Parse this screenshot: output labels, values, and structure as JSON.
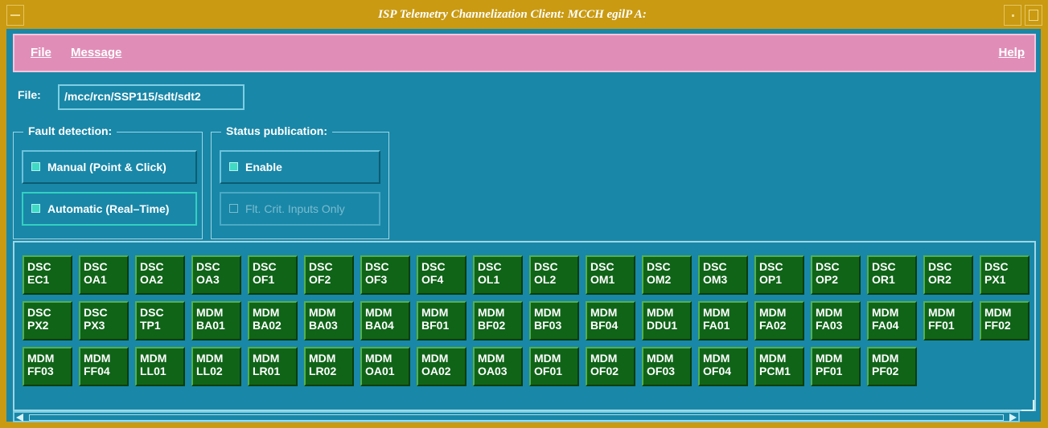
{
  "window": {
    "title": "ISP Telemetry Channelization Client: MCCH egilP A:"
  },
  "menubar": {
    "file": "File",
    "message": "Message",
    "help": "Help"
  },
  "file_row": {
    "label": "File:",
    "value": "/mcc/rcn/SSP115/sdt/sdt2"
  },
  "fault_detection": {
    "title": "Fault detection:",
    "manual": "Manual (Point & Click)",
    "automatic": "Automatic (Real–Time)",
    "selected": "automatic"
  },
  "status_publication": {
    "title": "Status publication:",
    "enable": "Enable",
    "flt_crit": "Flt. Crit. Inputs Only",
    "flt_crit_enabled": false
  },
  "channels": [
    [
      "DSC",
      "EC1"
    ],
    [
      "DSC",
      "OA1"
    ],
    [
      "DSC",
      "OA2"
    ],
    [
      "DSC",
      "OA3"
    ],
    [
      "DSC",
      "OF1"
    ],
    [
      "DSC",
      "OF2"
    ],
    [
      "DSC",
      "OF3"
    ],
    [
      "DSC",
      "OF4"
    ],
    [
      "DSC",
      "OL1"
    ],
    [
      "DSC",
      "OL2"
    ],
    [
      "DSC",
      "OM1"
    ],
    [
      "DSC",
      "OM2"
    ],
    [
      "DSC",
      "OM3"
    ],
    [
      "DSC",
      "OP1"
    ],
    [
      "DSC",
      "OP2"
    ],
    [
      "DSC",
      "OR1"
    ],
    [
      "DSC",
      "OR2"
    ],
    [
      "DSC",
      "PX1"
    ],
    [
      "DSC",
      "PX2"
    ],
    [
      "DSC",
      "PX3"
    ],
    [
      "DSC",
      "TP1"
    ],
    [
      "MDM",
      "BA01"
    ],
    [
      "MDM",
      "BA02"
    ],
    [
      "MDM",
      "BA03"
    ],
    [
      "MDM",
      "BA04"
    ],
    [
      "MDM",
      "BF01"
    ],
    [
      "MDM",
      "BF02"
    ],
    [
      "MDM",
      "BF03"
    ],
    [
      "MDM",
      "BF04"
    ],
    [
      "MDM",
      "DDU1"
    ],
    [
      "MDM",
      "FA01"
    ],
    [
      "MDM",
      "FA02"
    ],
    [
      "MDM",
      "FA03"
    ],
    [
      "MDM",
      "FA04"
    ],
    [
      "MDM",
      "FF01"
    ],
    [
      "MDM",
      "FF02"
    ],
    [
      "MDM",
      "FF03"
    ],
    [
      "MDM",
      "FF04"
    ],
    [
      "MDM",
      "LL01"
    ],
    [
      "MDM",
      "LL02"
    ],
    [
      "MDM",
      "LR01"
    ],
    [
      "MDM",
      "LR02"
    ],
    [
      "MDM",
      "OA01"
    ],
    [
      "MDM",
      "OA02"
    ],
    [
      "MDM",
      "OA03"
    ],
    [
      "MDM",
      "OF01"
    ],
    [
      "MDM",
      "OF02"
    ],
    [
      "MDM",
      "OF03"
    ],
    [
      "MDM",
      "OF04"
    ],
    [
      "MDM",
      "PCM1"
    ],
    [
      "MDM",
      "PF01"
    ],
    [
      "MDM",
      "PF02"
    ]
  ],
  "colors": {
    "frame": "#c99a12",
    "client": "#1987a8",
    "menubar": "#e08eb8",
    "channel": "#106418",
    "indicator": "#3fd9c4"
  }
}
